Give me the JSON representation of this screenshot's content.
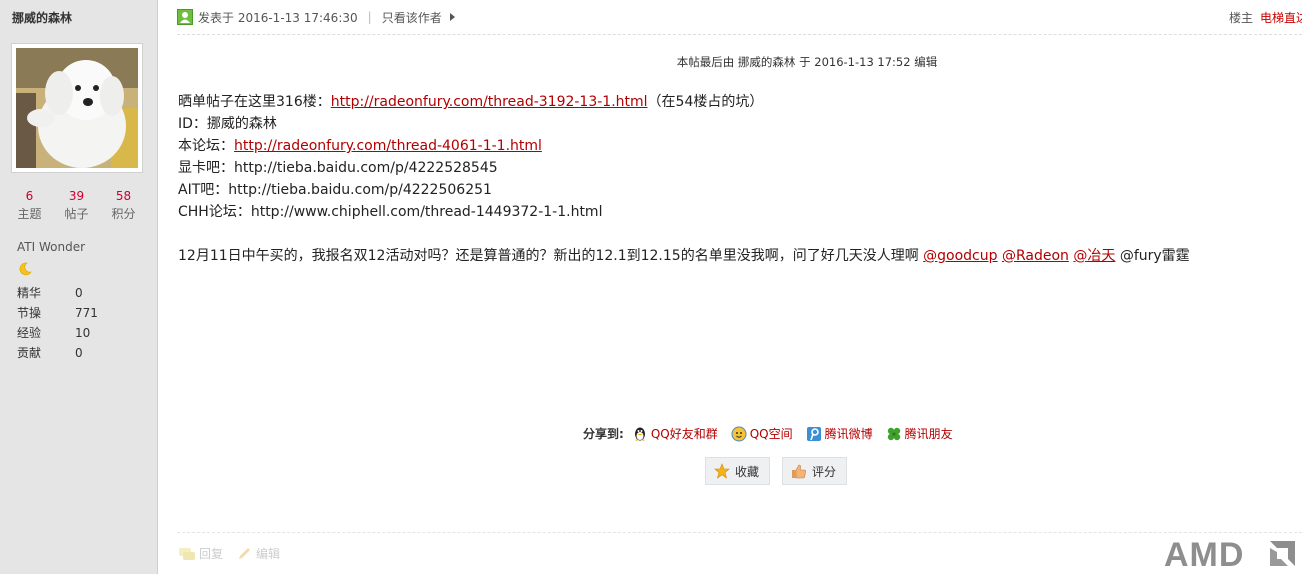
{
  "author": {
    "name": "挪威的森林",
    "stats": [
      {
        "num": "6",
        "label": "主题"
      },
      {
        "num": "39",
        "label": "帖子"
      },
      {
        "num": "58",
        "label": "积分"
      }
    ],
    "group": "ATI Wonder",
    "attrs": [
      {
        "k": "精华",
        "v": "0"
      },
      {
        "k": "节操",
        "v": "771"
      },
      {
        "k": "经验",
        "v": "10"
      },
      {
        "k": "贡献",
        "v": "0"
      }
    ]
  },
  "header": {
    "posted": "发表于 2016-1-13 17:46:30",
    "separator": "|",
    "only_author": "只看该作者",
    "floor_owner": "楼主",
    "floor_link": "电梯直达"
  },
  "edit_note": "本帖最后由 挪威的森林 于 2016-1-13 17:52 编辑",
  "content": {
    "line1_pre": "晒单帖子在这里316楼：",
    "line1_link": "http://radeonfury.com/thread-3192-13-1.html",
    "line1_post": "（在54楼占的坑）",
    "line2": "ID：挪威的森林",
    "line3_pre": "本论坛：",
    "line3_link": "http://radeonfury.com/thread-4061-1-1.html",
    "line4": "显卡吧：http://tieba.baidu.com/p/4222528545",
    "line5": "AIT吧：http://tieba.baidu.com/p/4222506251",
    "line6": "CHH论坛：http://www.chiphell.com/thread-1449372-1-1.html",
    "line7_pre": "12月11日中午买的，我报名双12活动对吗？还是算普通的？新出的12.1到12.15的名单里没我啊，问了好几天没人理啊 ",
    "mention1": "@goodcup",
    "mention2": "@Radeon",
    "mention3": "@冶天",
    "line7_post": " @fury雷霆"
  },
  "share": {
    "title": "分享到:",
    "items": [
      "QQ好友和群",
      "QQ空间",
      "腾讯微博",
      "腾讯朋友"
    ]
  },
  "buttons": {
    "favorite": "收藏",
    "rate": "评分"
  },
  "footer": {
    "reply": "回复",
    "edit": "编辑"
  },
  "watermark": "AMD"
}
